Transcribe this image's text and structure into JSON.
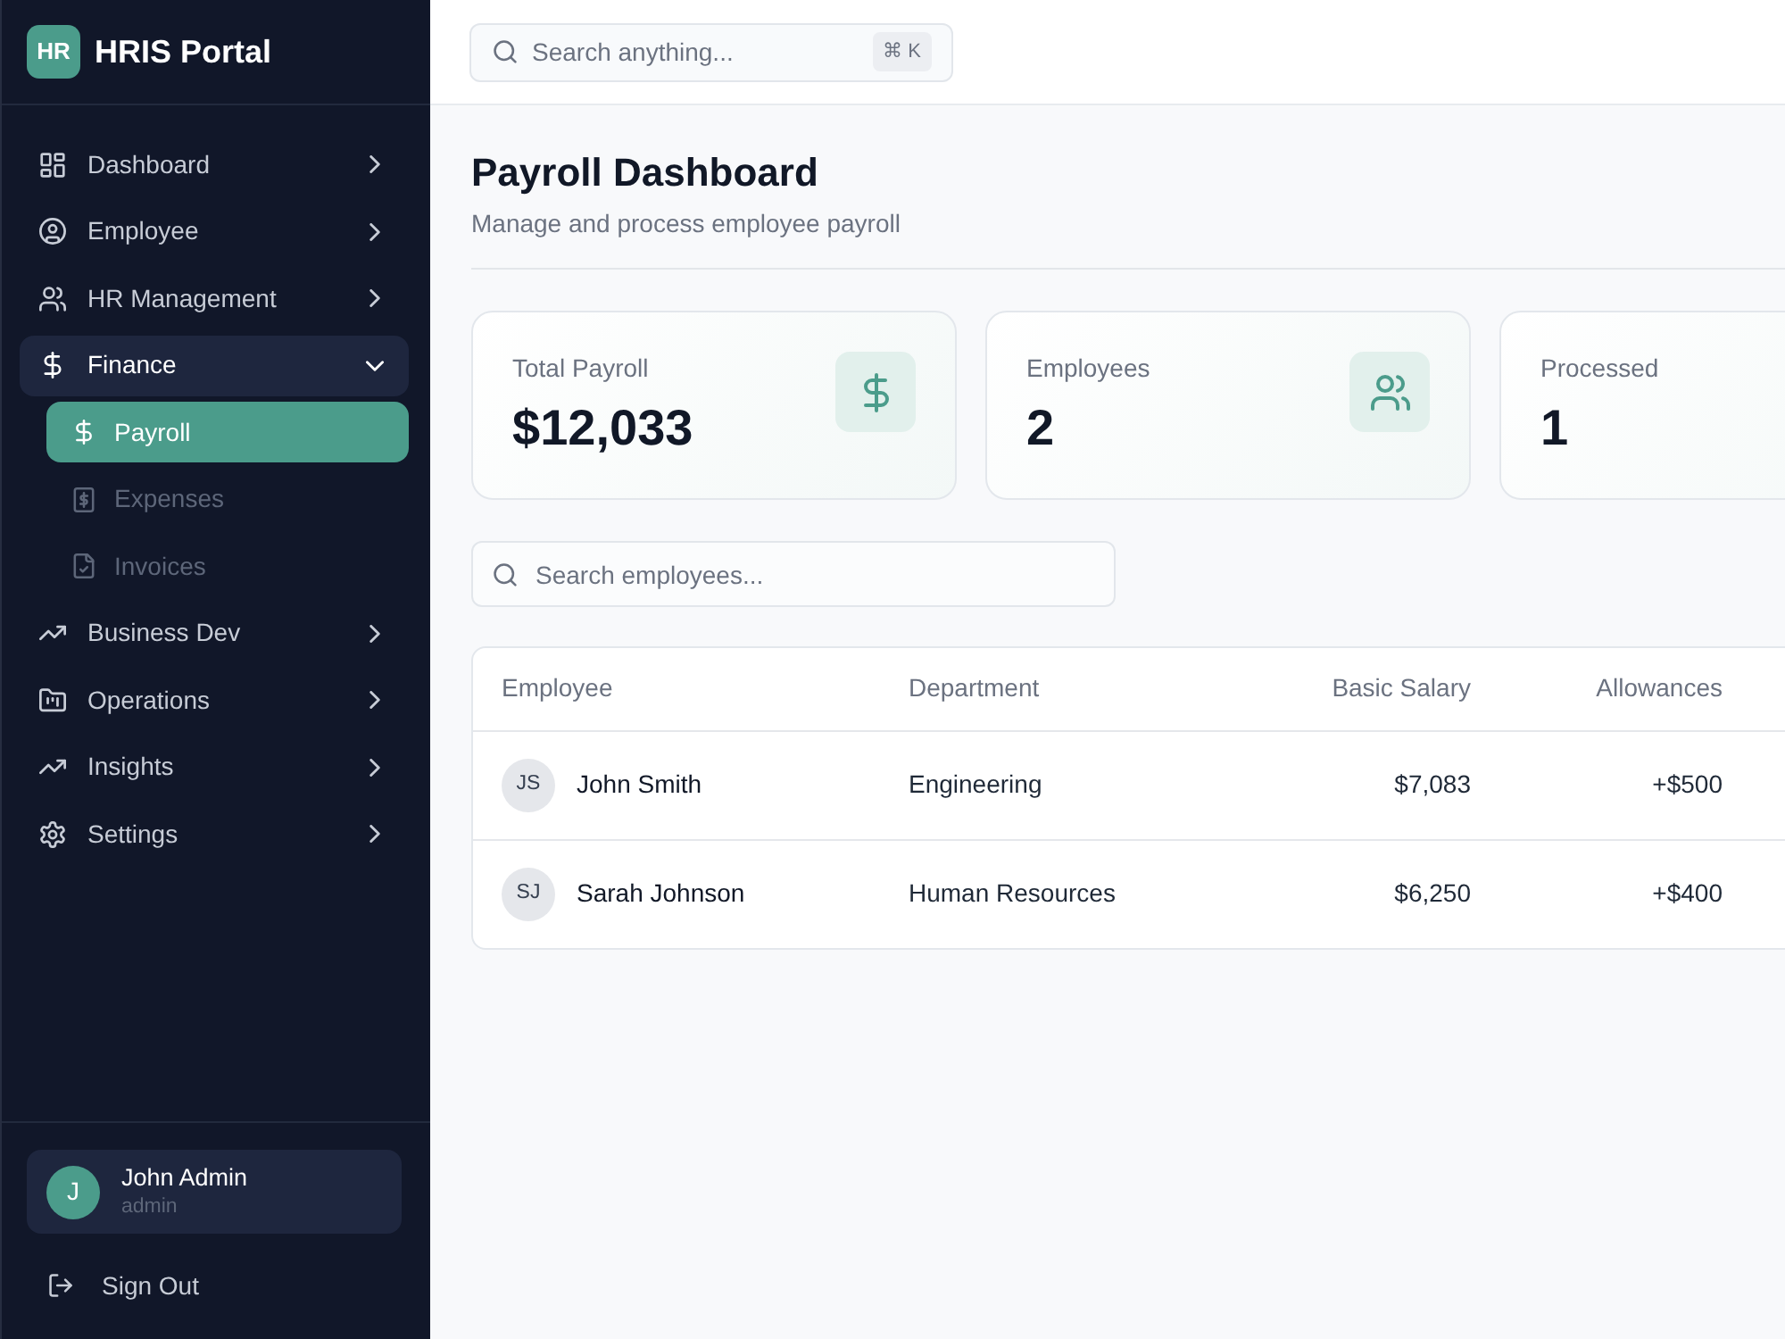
{
  "sidebar": {
    "logo": "HR",
    "title": "HRIS Portal",
    "items": [
      {
        "label": "Dashboard",
        "expanded": false
      },
      {
        "label": "Employee",
        "expanded": false
      },
      {
        "label": "HR Management",
        "expanded": false
      },
      {
        "label": "Finance",
        "expanded": true,
        "children": [
          {
            "label": "Payroll",
            "selected": true
          },
          {
            "label": "Expenses",
            "selected": false
          },
          {
            "label": "Invoices",
            "selected": false
          }
        ]
      },
      {
        "label": "Business Dev",
        "expanded": false
      },
      {
        "label": "Operations",
        "expanded": false
      },
      {
        "label": "Insights",
        "expanded": false
      },
      {
        "label": "Settings",
        "expanded": false
      }
    ],
    "user": {
      "initial": "J",
      "name": "John Admin",
      "role": "admin"
    },
    "sign_out": "Sign Out"
  },
  "topbar": {
    "search": {
      "placeholder": "Search anything...",
      "shortcut": "⌘ K"
    }
  },
  "page": {
    "title": "Payroll Dashboard",
    "subtitle": "Manage and process employee payroll"
  },
  "stats": [
    {
      "label": "Total Payroll",
      "value": "$12,033"
    },
    {
      "label": "Employees",
      "value": "2"
    },
    {
      "label": "Processed",
      "value": "1"
    }
  ],
  "employee_search": {
    "placeholder": "Search employees..."
  },
  "table": {
    "columns": [
      "Employee",
      "Department",
      "Basic Salary",
      "Allowances"
    ],
    "rows": [
      {
        "initials": "JS",
        "name": "John Smith",
        "department": "Engineering",
        "basic_salary": "$7,083",
        "allowances": "+$500"
      },
      {
        "initials": "SJ",
        "name": "Sarah Johnson",
        "department": "Human Resources",
        "basic_salary": "$6,250",
        "allowances": "+$400"
      }
    ]
  }
}
